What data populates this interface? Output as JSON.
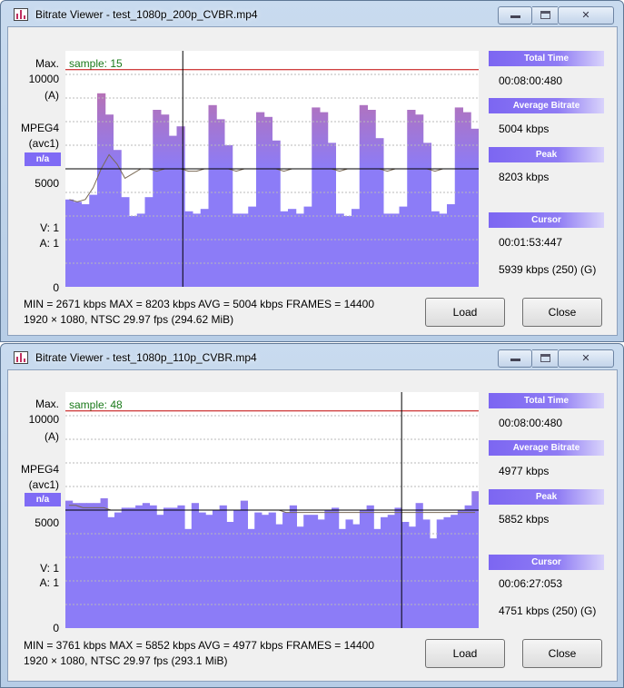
{
  "windows": [
    {
      "title": "Bitrate Viewer - test_1080p_200p_CVBR.mp4",
      "sample_label": "sample: 15",
      "axis": {
        "max_label": "Max.",
        "top_value": "10000",
        "mode": "(A)",
        "codec": "MPEG4",
        "codec_detail": "(avc1)",
        "badge": "n/a",
        "mid_value": "5000",
        "v_label": "V:  1",
        "a_label": "A:  1",
        "zero": "0"
      },
      "panel": {
        "total_time_label": "Total Time",
        "total_time": "00:08:00:480",
        "avg_label": "Average Bitrate",
        "avg": "5004 kbps",
        "peak_label": "Peak",
        "peak": "8203 kbps",
        "cursor_label": "Cursor",
        "cursor_time": "00:01:53:447",
        "cursor_value": "5939 kbps (250) (G)"
      },
      "stats_line1": "MIN = 2671 kbps  MAX = 8203 kbps  AVG = 5004 kbps  FRAMES = 14400",
      "stats_line2": "1920 × 1080, NTSC 29.97 fps      (294.62 MiB)",
      "load_label": "Load",
      "close_label": "Close",
      "chart_data": {
        "type": "bar",
        "ylim": [
          0,
          10000
        ],
        "max_line": 8203,
        "avg_line": 5004,
        "cursor_sample": 15,
        "values": [
          3700,
          3600,
          3500,
          3900,
          8200,
          7300,
          5800,
          3800,
          3000,
          3100,
          3800,
          7500,
          7300,
          6400,
          6800,
          3200,
          3100,
          3300,
          7700,
          7100,
          6000,
          3100,
          3100,
          3400,
          7400,
          7200,
          6200,
          3200,
          3300,
          3100,
          3400,
          7600,
          7400,
          6100,
          3100,
          3000,
          3300,
          7700,
          7500,
          6300,
          3100,
          3100,
          3400,
          7500,
          7300,
          6100,
          3200,
          3100,
          3500,
          7600,
          7400,
          6700
        ],
        "line_values": [
          3700,
          3600,
          3700,
          4200,
          5000,
          5600,
          5200,
          4600,
          4800,
          5000,
          5000,
          4900,
          5000,
          5000,
          5000,
          4900,
          4900,
          5000,
          5000,
          5000,
          5000,
          4900,
          5000,
          5000,
          5000,
          5000,
          5000,
          4900,
          5000,
          5000,
          5000,
          5000,
          5000,
          5000,
          4900,
          5000,
          5000,
          5000,
          5000,
          5000,
          4900,
          5000,
          5000,
          5000,
          5000,
          5000,
          4900,
          5000,
          5000,
          5000,
          5000,
          5000
        ],
        "series_colors": {
          "upper": "#c06fa6",
          "lower": "#8c7cf7"
        }
      }
    },
    {
      "title": "Bitrate Viewer - test_1080p_110p_CVBR.mp4",
      "sample_label": "sample: 48",
      "axis": {
        "max_label": "Max.",
        "top_value": "10000",
        "mode": "(A)",
        "codec": "MPEG4",
        "codec_detail": "(avc1)",
        "badge": "n/a",
        "mid_value": "5000",
        "v_label": "V:  1",
        "a_label": "A:  1",
        "zero": "0"
      },
      "panel": {
        "total_time_label": "Total Time",
        "total_time": "00:08:00:480",
        "avg_label": "Average Bitrate",
        "avg": "4977 kbps",
        "peak_label": "Peak",
        "peak": "5852 kbps",
        "cursor_label": "Cursor",
        "cursor_time": "00:06:27:053",
        "cursor_value": "4751 kbps (250) (G)"
      },
      "stats_line1": "MIN = 3761 kbps  MAX = 5852 kbps  AVG = 4977 kbps  FRAMES = 14400",
      "stats_line2": "1920 × 1080, NTSC 29.97 fps      (293.1 MiB)",
      "load_label": "Load",
      "close_label": "Close",
      "chart_data": {
        "type": "bar",
        "ylim": [
          0,
          10000
        ],
        "max_line": 5852,
        "avg_line": 4977,
        "cursor_sample": 48,
        "values": [
          5400,
          5300,
          5300,
          5300,
          5300,
          5500,
          4700,
          4900,
          5100,
          5100,
          5200,
          5300,
          5200,
          4800,
          5100,
          5100,
          5200,
          4200,
          5300,
          4900,
          4800,
          5000,
          5200,
          4500,
          5000,
          5400,
          4200,
          4900,
          4800,
          4900,
          4400,
          4900,
          5200,
          4300,
          4800,
          4800,
          4600,
          5000,
          5100,
          4200,
          4600,
          4400,
          5000,
          5200,
          4200,
          4700,
          4800,
          5100,
          4500,
          4300,
          5300,
          4600,
          3800,
          4600,
          4700,
          4800,
          5000,
          5200,
          5800
        ],
        "line_values": [
          5200,
          5200,
          5100,
          5100,
          5100,
          5100,
          5000,
          5000,
          5000,
          5000,
          5000,
          5000,
          5000,
          5000,
          5000,
          5000,
          5000,
          5000,
          5000,
          5000,
          5000,
          5000,
          5000,
          5000,
          5000,
          5000,
          5000,
          5000,
          5000,
          5000,
          5000,
          4900,
          4900,
          4900,
          4900,
          4900,
          4900,
          4900,
          4900,
          4900,
          4900,
          4900,
          4900,
          4900,
          4900,
          4900,
          4900,
          4900,
          4900,
          4900,
          4900,
          4900,
          4900,
          4900,
          4900,
          4900,
          4900,
          4900,
          4900
        ],
        "series_colors": {
          "upper": "#c06fa6",
          "lower": "#8c7cf7"
        }
      }
    }
  ]
}
